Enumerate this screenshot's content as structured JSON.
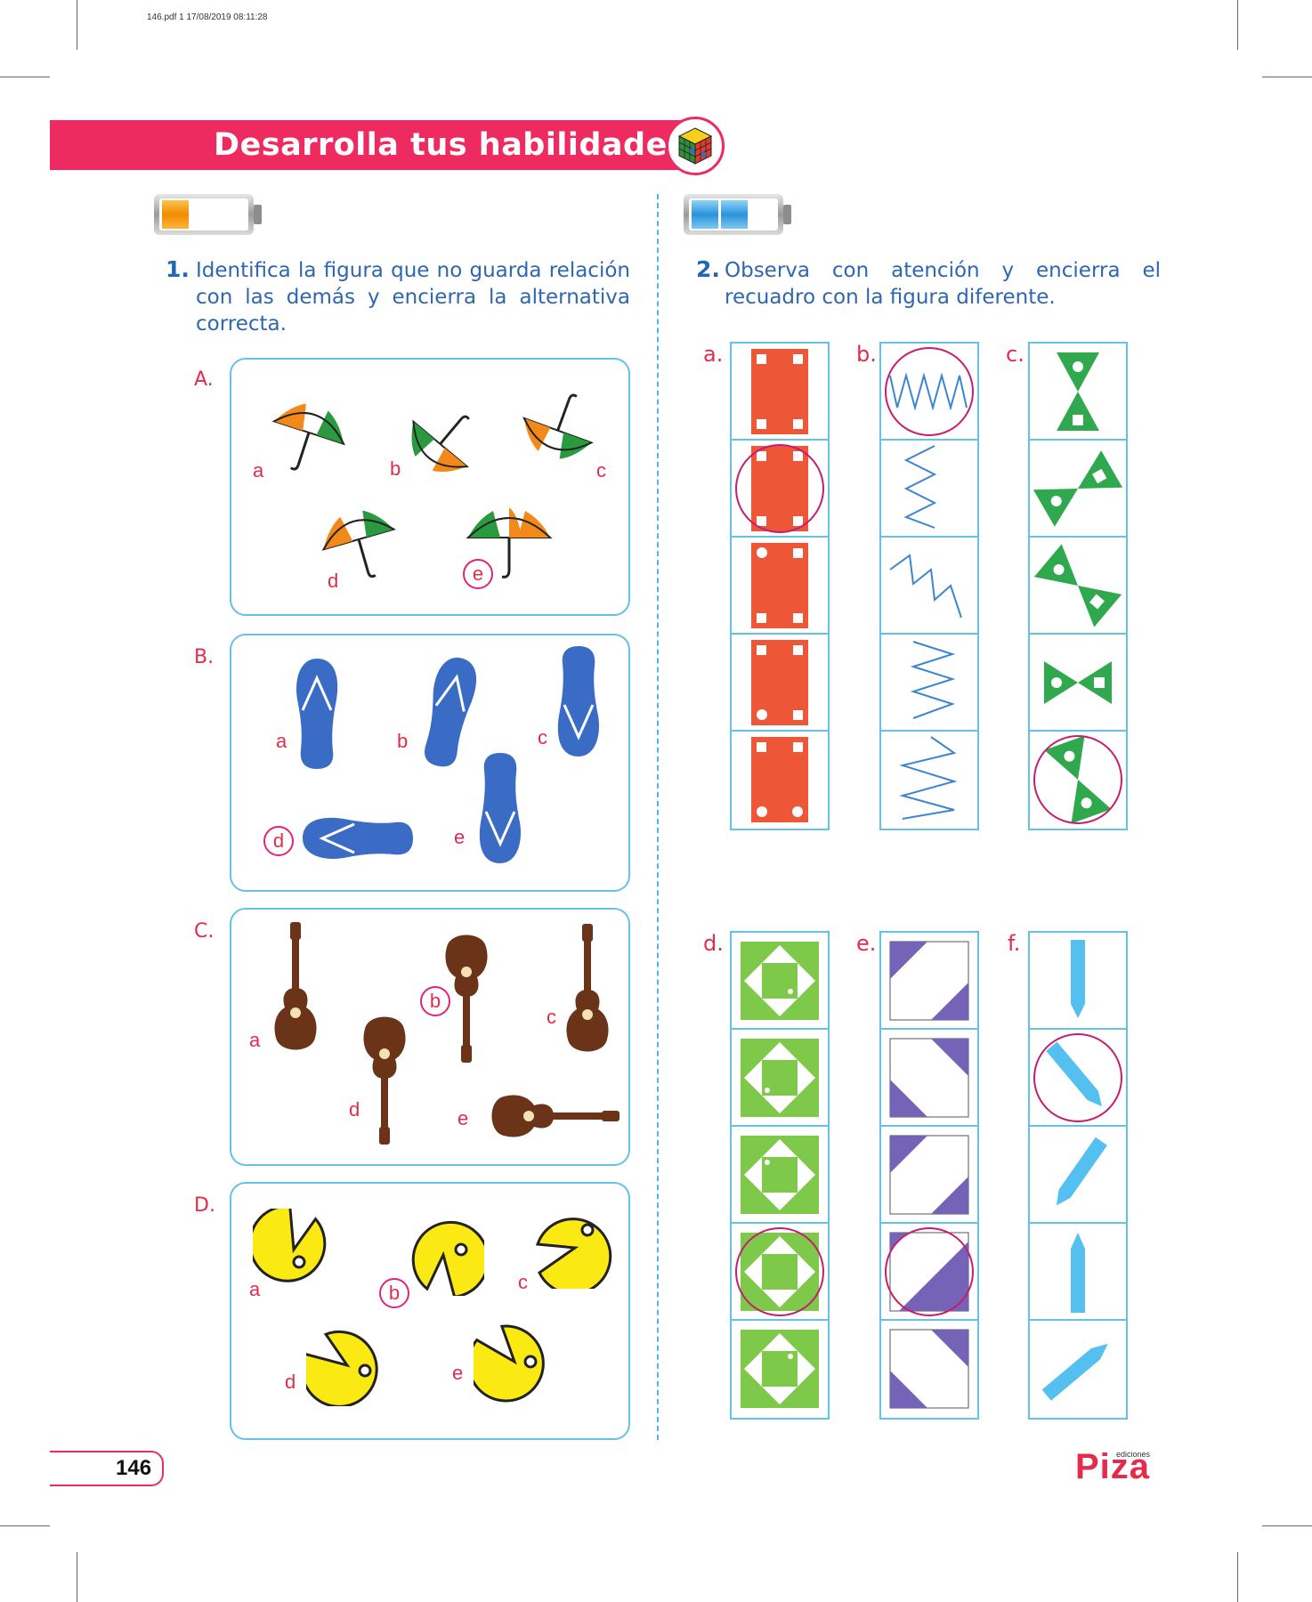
{
  "print_meta": "146.pdf   1   17/08/2019   08:11:28",
  "header": {
    "title": "Desarrolla tus habilidades"
  },
  "colors": {
    "accent": "#ee2b60",
    "text_blue": "#2e67b0",
    "panel_border": "#63c2e6",
    "label_red": "#e32c4c",
    "circle_magenta": "#c51d73"
  },
  "question1": {
    "number": "1.",
    "text": "Identifica la figura que no guarda relación con las demás y encierra la alternativa correcta.",
    "sections": [
      {
        "label": "A.",
        "item": "umbrella-icon",
        "options": [
          "a",
          "b",
          "c",
          "d",
          "e"
        ],
        "answer": "e"
      },
      {
        "label": "B.",
        "item": "flip-flop-icon",
        "options": [
          "a",
          "b",
          "c",
          "d",
          "e"
        ],
        "answer": "d"
      },
      {
        "label": "C.",
        "item": "ukulele-icon",
        "options": [
          "a",
          "b",
          "c",
          "d",
          "e"
        ],
        "answer": "b"
      },
      {
        "label": "D.",
        "item": "pacman-icon",
        "options": [
          "a",
          "b",
          "c",
          "d",
          "e"
        ],
        "answer": "b"
      }
    ]
  },
  "question2": {
    "number": "2.",
    "text": "Observa con atención y encierra el recuadro con la figura diferente.",
    "columns": [
      {
        "label": "a.",
        "figure": "red-card-with-dots",
        "answer_index": 2
      },
      {
        "label": "b.",
        "figure": "blue-zigzag",
        "answer_index": 1
      },
      {
        "label": "c.",
        "figure": "green-bowtie",
        "answer_index": 5
      },
      {
        "label": "d.",
        "figure": "green-diamond-tile",
        "answer_index": 4
      },
      {
        "label": "e.",
        "figure": "purple-corner-tile",
        "answer_index": 4
      },
      {
        "label": "f.",
        "figure": "blue-pencil",
        "answer_index": 2
      }
    ]
  },
  "footer": {
    "page_number": "146",
    "logo": "Piza",
    "logo_sub": "ediciones"
  }
}
